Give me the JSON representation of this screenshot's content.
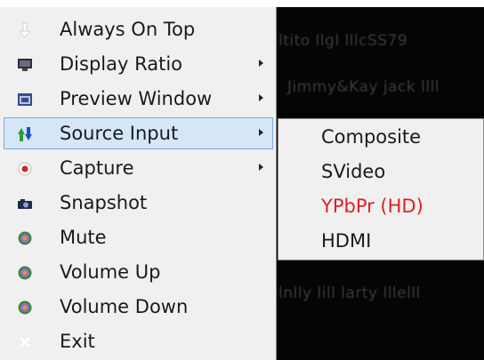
{
  "video_overlay_text": [
    "ltito  llgl   lllcSS79",
    "Jimmy&Kay  jack  llll",
    "lnlly  lill  larty  lllelll"
  ],
  "main_menu": {
    "items": [
      {
        "label": "Always On Top",
        "icon": "down-arrow-icon",
        "has_submenu": false
      },
      {
        "label": "Display Ratio",
        "icon": "monitor-icon",
        "has_submenu": true
      },
      {
        "label": "Preview Window",
        "icon": "window-icon",
        "has_submenu": true
      },
      {
        "label": "Source Input",
        "icon": "swap-arrows-icon",
        "has_submenu": true,
        "highlighted": true
      },
      {
        "label": "Capture",
        "icon": "record-icon",
        "has_submenu": true
      },
      {
        "label": "Snapshot",
        "icon": "camera-icon",
        "has_submenu": false
      },
      {
        "label": "Mute",
        "icon": "speaker-icon",
        "has_submenu": false
      },
      {
        "label": "Volume Up",
        "icon": "speaker-icon",
        "has_submenu": false
      },
      {
        "label": "Volume Down",
        "icon": "speaker-icon",
        "has_submenu": false
      },
      {
        "label": "Exit",
        "icon": "close-x-icon",
        "has_submenu": false
      }
    ]
  },
  "source_submenu": {
    "items": [
      {
        "label": "Composite"
      },
      {
        "label": "SVideo"
      },
      {
        "label": "YPbPr (HD)",
        "selected": true
      },
      {
        "label": "HDMI"
      }
    ]
  },
  "colors": {
    "menu_bg": "#f0f0f0",
    "highlight_bg": "#d5e6f7",
    "highlight_border": "#7ea8d8",
    "selected_text": "#e02020",
    "video_bg": "#050505"
  }
}
